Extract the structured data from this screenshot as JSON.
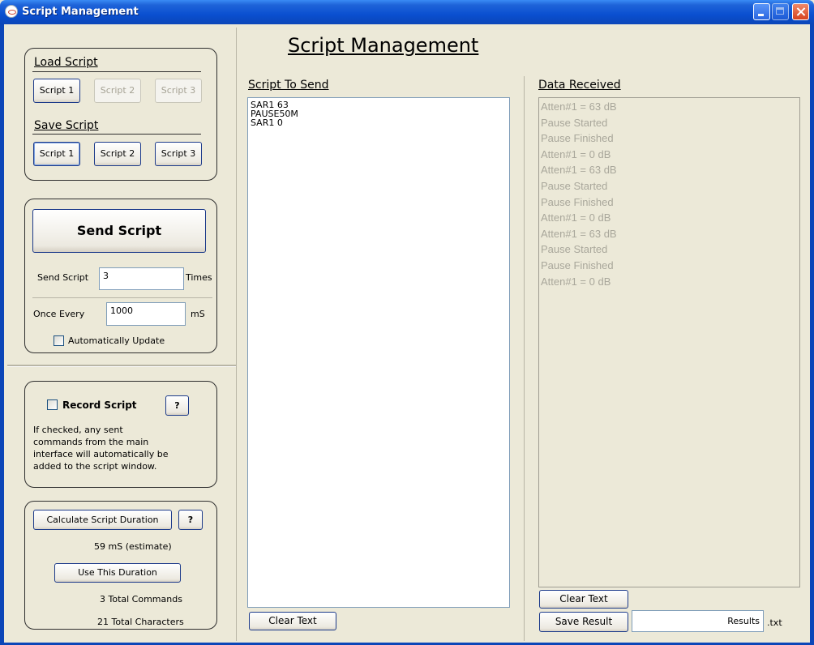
{
  "window": {
    "title": "Script Management"
  },
  "header": {
    "title": "Script Management"
  },
  "load_script": {
    "label": "Load Script",
    "buttons": [
      "Script 1",
      "Script 2",
      "Script 3"
    ]
  },
  "save_script": {
    "label": "Save Script",
    "buttons": [
      "Script 1",
      "Script 2",
      "Script 3"
    ]
  },
  "send": {
    "button": "Send Script",
    "send_label": "Send Script",
    "times_value": "3",
    "times_unit": "Times",
    "every_label": "Once Every",
    "every_value": "1000",
    "every_unit": "mS",
    "auto_update_label": "Automatically Update"
  },
  "record": {
    "label": "Record Script",
    "help": "?",
    "description_lines": [
      "If checked, any sent",
      "commands from the main",
      "interface will automatically be",
      "added to the script window."
    ]
  },
  "duration": {
    "calc_button": "Calculate Script Duration",
    "help": "?",
    "estimate": "59 mS (estimate)",
    "use_button": "Use This Duration",
    "total_commands": "3 Total Commands",
    "total_characters": "21 Total Characters"
  },
  "script_to_send": {
    "label": "Script To Send",
    "lines": [
      "SAR1 63",
      "PAUSE50M",
      "SAR1 0"
    ],
    "clear_button": "Clear Text"
  },
  "data_received": {
    "label": "Data Received",
    "lines": [
      "Atten#1 = 63 dB",
      "Pause Started",
      "Pause Finished",
      "Atten#1 =  0 dB",
      "Atten#1 = 63 dB",
      "Pause Started",
      "Pause Finished",
      "Atten#1 =  0 dB",
      "Atten#1 = 63 dB",
      "Pause Started",
      "Pause Finished",
      "Atten#1 =  0 dB"
    ],
    "clear_button": "Clear Text",
    "save_button": "Save Result",
    "filename_value": "Results",
    "extension": ".txt"
  }
}
